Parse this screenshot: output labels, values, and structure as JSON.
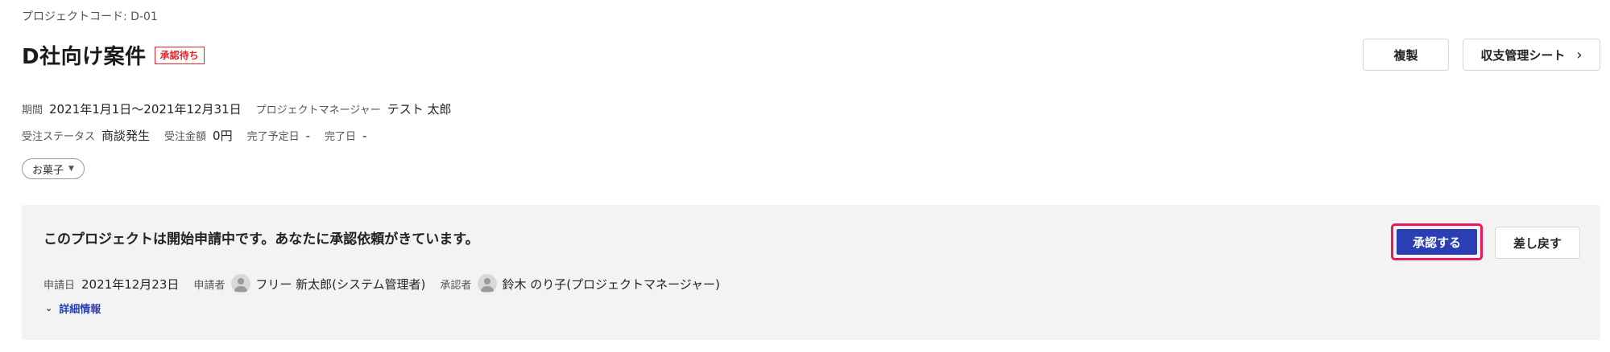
{
  "header": {
    "project_code": "プロジェクトコード: D-01",
    "title": "D社向け案件",
    "status": "承認待ち",
    "duplicate_label": "複製",
    "budget_sheet_label": "収支管理シート",
    "chevron": "›"
  },
  "meta": {
    "period_label": "期間",
    "period_value": "2021年1月1日〜2021年12月31日",
    "pm_label": "プロジェクトマネージャー",
    "pm_value": "テスト 太郎",
    "order_status_label": "受注ステータス",
    "order_status_value": "商談発生",
    "order_amount_label": "受注金額",
    "order_amount_value": "0円",
    "planned_end_label": "完了予定日",
    "planned_end_value": "-",
    "end_label": "完了日",
    "end_value": "-"
  },
  "tag": {
    "label": "お菓子",
    "caret": "▼"
  },
  "approval": {
    "message": "このプロジェクトは開始申請中です。あなたに承認依頼がきています。",
    "approve_label": "承認する",
    "return_label": "差し戻す",
    "apply_date_label": "申請日",
    "apply_date_value": "2021年12月23日",
    "applicant_label": "申請者",
    "applicant_value": "フリー 新太郎(システム管理者)",
    "approver_label": "承認者",
    "approver_value": "鈴木 のり子(プロジェクトマネージャー)",
    "details_label": "詳細情報",
    "details_chevron": "⌄"
  },
  "colors": {
    "status_red": "#e0272c",
    "primary_blue": "#2a3fb4",
    "highlight_pink": "#e8185e",
    "panel_bg": "#f4f3f3"
  }
}
